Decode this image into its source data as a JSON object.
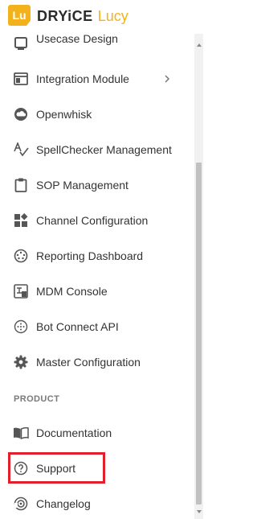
{
  "brand": {
    "badge_text": "Lu",
    "name_strong": "DRYiCE",
    "name_light": "Lucy",
    "accent_color": "#f3b21b"
  },
  "menu": {
    "items": [
      {
        "label": "Usecase Design",
        "icon": "usecase-icon"
      },
      {
        "label": "Integration Module",
        "icon": "window-icon",
        "has_submenu": true
      },
      {
        "label": "Openwhisk",
        "icon": "cloud-icon"
      },
      {
        "label": "SpellChecker Management",
        "icon": "spellcheck-icon"
      },
      {
        "label": "SOP Management",
        "icon": "clipboard-icon"
      },
      {
        "label": "Channel Configuration",
        "icon": "widgets-icon"
      },
      {
        "label": "Reporting Dashboard",
        "icon": "dashboard-icon"
      },
      {
        "label": "MDM Console",
        "icon": "translate-icon"
      },
      {
        "label": "Bot Connect API",
        "icon": "dots-circle-icon"
      },
      {
        "label": "Master Configuration",
        "icon": "gear-icon"
      }
    ],
    "product_section": {
      "title": "PRODUCT",
      "items": [
        {
          "label": "Documentation",
          "icon": "book-icon"
        },
        {
          "label": "Support",
          "icon": "help-circle-icon",
          "highlighted": true
        },
        {
          "label": "Changelog",
          "icon": "changelog-icon"
        }
      ]
    }
  },
  "colors": {
    "highlight_border": "#e0202a",
    "icon": "#555555"
  }
}
